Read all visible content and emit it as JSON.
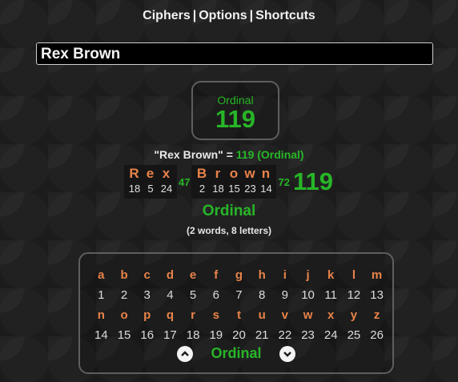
{
  "nav": {
    "ciphers": "Ciphers",
    "options": "Options",
    "shortcuts": "Shortcuts",
    "sep": "|"
  },
  "search": {
    "value": "Rex Brown"
  },
  "cipher_box": {
    "name": "Ordinal",
    "value": "119"
  },
  "equation": {
    "phrase": "\"Rex Brown\"",
    "equals": "=",
    "value": "119",
    "cipher": "(Ordinal)"
  },
  "breakdown": {
    "words": [
      {
        "letters": [
          {
            "ch": "R",
            "val": "18"
          },
          {
            "ch": "e",
            "val": "5"
          },
          {
            "ch": "x",
            "val": "24"
          }
        ],
        "sum": "47"
      },
      {
        "letters": [
          {
            "ch": "B",
            "val": "2"
          },
          {
            "ch": "r",
            "val": "18"
          },
          {
            "ch": "o",
            "val": "15"
          },
          {
            "ch": "w",
            "val": "23"
          },
          {
            "ch": "n",
            "val": "14"
          }
        ],
        "sum": "72"
      }
    ],
    "total": "119"
  },
  "cipher_label": "Ordinal",
  "counts": "(2 words, 8 letters)",
  "chart": {
    "rows": [
      {
        "letters": [
          "a",
          "b",
          "c",
          "d",
          "e",
          "f",
          "g",
          "h",
          "i",
          "j",
          "k",
          "l",
          "m"
        ],
        "values": [
          "1",
          "2",
          "3",
          "4",
          "5",
          "6",
          "7",
          "8",
          "9",
          "10",
          "11",
          "12",
          "13"
        ]
      },
      {
        "letters": [
          "n",
          "o",
          "p",
          "q",
          "r",
          "s",
          "t",
          "u",
          "v",
          "w",
          "x",
          "y",
          "z"
        ],
        "values": [
          "14",
          "15",
          "16",
          "17",
          "18",
          "19",
          "20",
          "21",
          "22",
          "23",
          "24",
          "25",
          "26"
        ]
      }
    ],
    "title": "Ordinal"
  },
  "colors": {
    "green": "#27b627",
    "orange": "#e8834a"
  }
}
